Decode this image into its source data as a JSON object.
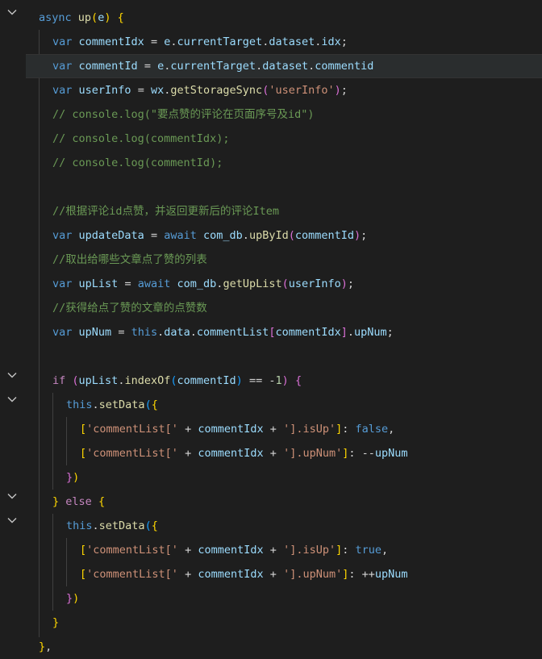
{
  "editor": {
    "fold_marker": "⌄",
    "lines": [
      {
        "text": "async up(e) {"
      },
      {
        "text": "var commentIdx = e.currentTarget.dataset.idx;"
      },
      {
        "text": "var commentId = e.currentTarget.dataset.commentid"
      },
      {
        "text": "var userInfo = wx.getStorageSync('userInfo');"
      },
      {
        "text": "// console.log(\"要点赞的评论在页面序号及id\")"
      },
      {
        "text": "// console.log(commentIdx);"
      },
      {
        "text": "// console.log(commentId);"
      },
      {
        "text": ""
      },
      {
        "text": "//根据评论id点赞，并返回更新后的评论Item"
      },
      {
        "text": "var updateData = await com_db.upById(commentId);"
      },
      {
        "text": "//取出给哪些文章点了赞的列表"
      },
      {
        "text": "var upList = await com_db.getUpList(userInfo);"
      },
      {
        "text": "//获得给点了赞的文章的点赞数"
      },
      {
        "text": "var upNum = this.data.commentList[commentIdx].upNum;"
      },
      {
        "text": ""
      },
      {
        "text": "if (upList.indexOf(commentId) == -1) {"
      },
      {
        "text": "this.setData({"
      },
      {
        "text": "['commentList[' + commentIdx + '].isUp']: false,"
      },
      {
        "text": "['commentList[' + commentIdx + '].upNum']: --upNum"
      },
      {
        "text": "})"
      },
      {
        "text": "} else {"
      },
      {
        "text": "this.setData({"
      },
      {
        "text": "['commentList[' + commentIdx + '].isUp']: true,"
      },
      {
        "text": "['commentList[' + commentIdx + '].upNum']: ++upNum"
      },
      {
        "text": "})"
      },
      {
        "text": "}"
      },
      {
        "text": "},"
      }
    ]
  },
  "colors": {
    "background": "#1e1e1e",
    "keyword": "#569cd6",
    "control_keyword": "#c586c0",
    "variable": "#9cdcfe",
    "function": "#dcdcaa",
    "string": "#ce9178",
    "number": "#b5cea8",
    "comment": "#6a9955",
    "bracket_level1": "#ffd700",
    "bracket_level2": "#da70d6",
    "bracket_level3": "#179fff",
    "active_line": "#2a2d2e"
  }
}
